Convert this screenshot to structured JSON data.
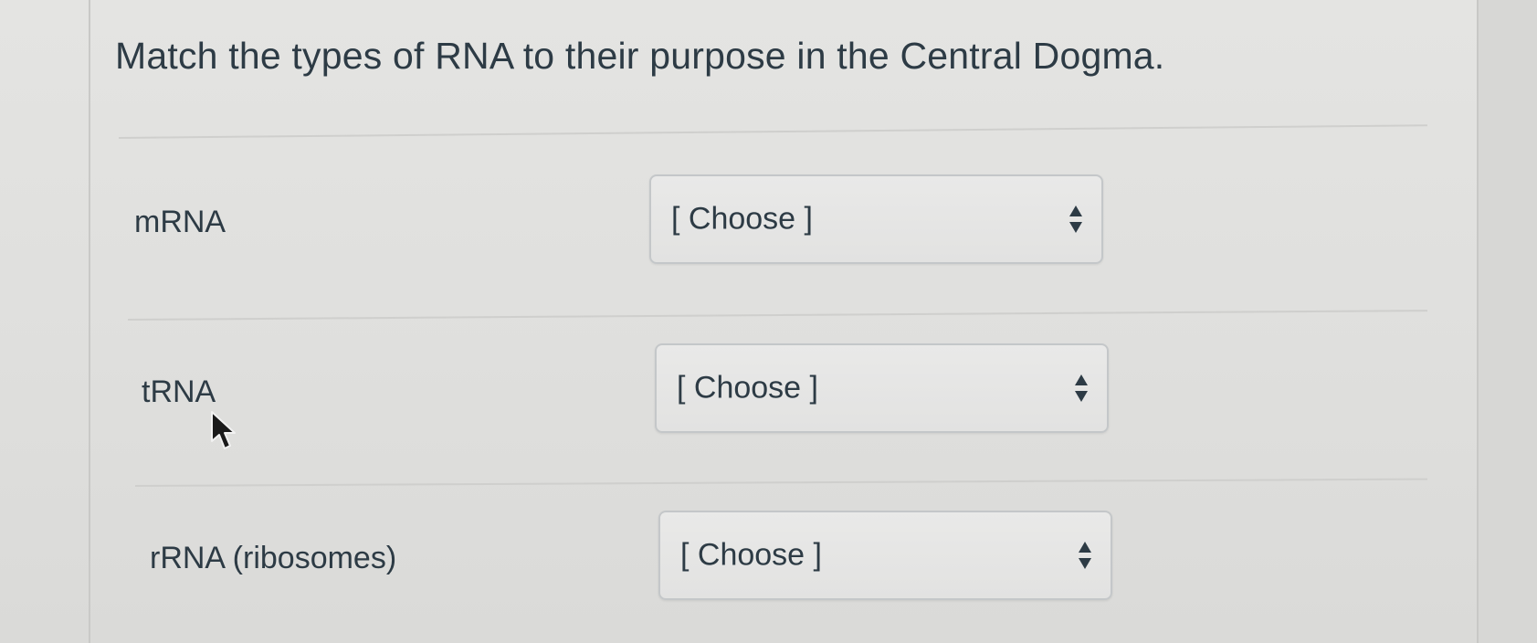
{
  "question": {
    "text": "Match the types of RNA to their purpose in the Central Dogma."
  },
  "rows": [
    {
      "label": "mRNA",
      "select_value": "[ Choose ]"
    },
    {
      "label": "tRNA",
      "select_value": "[ Choose ]"
    },
    {
      "label": "rRNA (ribosomes)",
      "select_value": "[ Choose ]"
    }
  ],
  "icons": {
    "select_arrows": "up-down-arrows-icon",
    "pointer": "mouse-pointer-icon"
  },
  "colors": {
    "text": "#2d3b45",
    "select_border": "#c4c7c9",
    "background": "#e1e1df"
  }
}
